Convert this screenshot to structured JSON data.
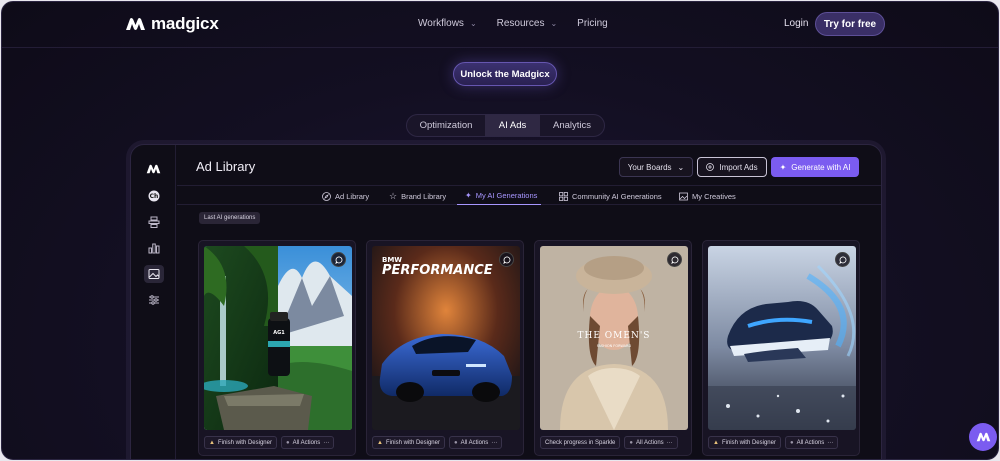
{
  "nav": {
    "brand": "madgicx",
    "links": [
      {
        "label": "Workflows",
        "dropdown": true
      },
      {
        "label": "Resources",
        "dropdown": true
      },
      {
        "label": "Pricing",
        "dropdown": false
      }
    ],
    "login": "Login",
    "cta": "Try for free"
  },
  "hero": {
    "unlock": "Unlock the Madgicx"
  },
  "segmented": {
    "items": [
      "Optimization",
      "AI Ads",
      "Analytics"
    ],
    "active": "AI Ads"
  },
  "app": {
    "title": "Ad Library",
    "boards_button": "Your Boards",
    "import_button": "Import Ads",
    "generate_button": "Generate with AI",
    "subtabs": [
      "Ad Library",
      "Brand Library",
      "My AI Generations",
      "Community AI Generations",
      "My Creatives"
    ],
    "active_subtab": "My AI Generations",
    "chip": "Last AI generations",
    "cards": [
      {
        "image": "supplement-landscape",
        "actions": [
          "Finish with Designer",
          "All Actions"
        ]
      },
      {
        "image": "bmw-performance",
        "overlay": "BMW",
        "overlay_big": "PERFORMANCE",
        "actions": [
          "Finish with Designer",
          "All Actions"
        ]
      },
      {
        "image": "fashion-portrait",
        "overlay": "THE OMEN'S",
        "overlay_sub": "FASHION FORWARD",
        "actions": [
          "Check progress in Sparkle",
          "All Actions"
        ]
      },
      {
        "image": "sneaker-splash",
        "actions": [
          "Finish with Designer",
          "All Actions"
        ]
      }
    ]
  },
  "colors": {
    "accent": "#7b5cf0",
    "bg": "#130f22",
    "active_tab": "#a796ff"
  }
}
